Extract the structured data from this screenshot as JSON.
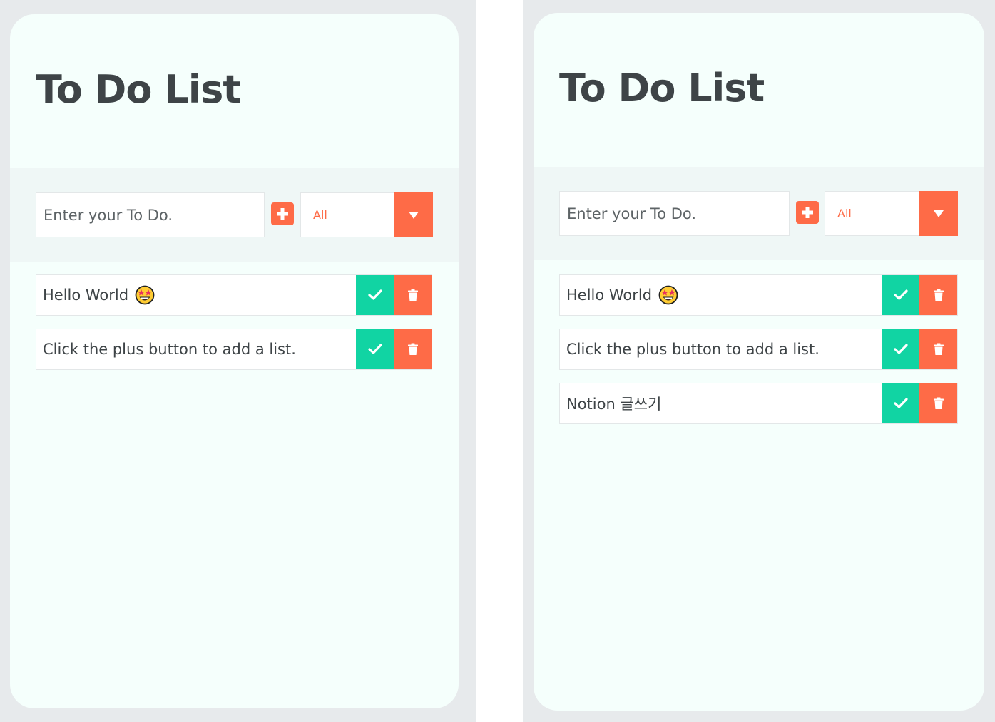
{
  "panels": [
    {
      "title": "To Do List",
      "input": {
        "placeholder": "Enter your To Do.",
        "value": ""
      },
      "filter": {
        "selected": "All"
      },
      "todos": [
        {
          "text": "Hello World",
          "emoji": "star-struck-emoji"
        },
        {
          "text": "Click the plus button to add a list."
        }
      ]
    },
    {
      "title": "To Do List",
      "input": {
        "placeholder": "Enter your To Do.",
        "value": ""
      },
      "filter": {
        "selected": "All"
      },
      "todos": [
        {
          "text": "Hello World",
          "emoji": "star-struck-emoji"
        },
        {
          "text": "Click the plus button to add a list."
        },
        {
          "text": "Notion 글쓰기"
        }
      ]
    }
  ],
  "colors": {
    "accent": "#fe6b47",
    "complete": "#11d4a3",
    "card": "#f5fffc",
    "band": "#eff7f6",
    "page": "#e7eaec",
    "text": "#3e4447"
  },
  "icons": {
    "add": "plus-icon",
    "dropdown": "caret-down-icon",
    "complete": "check-icon",
    "delete": "trash-icon"
  }
}
